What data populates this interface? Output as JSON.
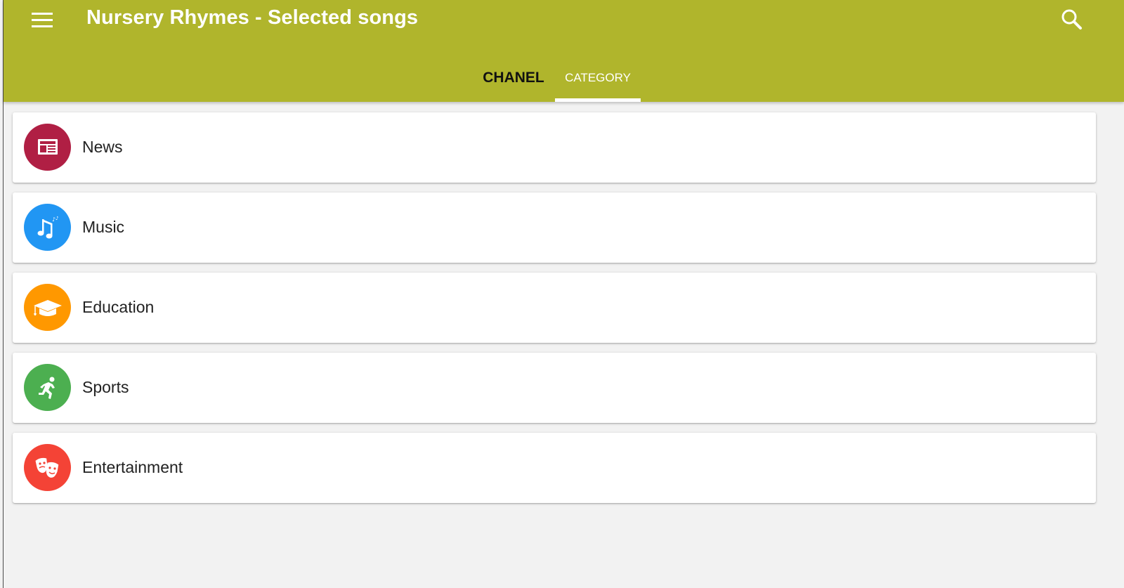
{
  "app": {
    "title": "Nursery Rhymes - Selected songs"
  },
  "tabs": [
    {
      "label": "CHANEL",
      "active": false
    },
    {
      "label": "CATEGORY",
      "active": true
    }
  ],
  "colors": {
    "appbar": "#b0b52c",
    "background": "#f2f2f2",
    "active_tab_indicator": "#ffffff"
  },
  "categories": [
    {
      "label": "News",
      "icon": "newspaper-icon",
      "color": "#b01f44"
    },
    {
      "label": "Music",
      "icon": "music-note-icon",
      "color": "#2196f3"
    },
    {
      "label": "Education",
      "icon": "graduation-cap-icon",
      "color": "#ff9800"
    },
    {
      "label": "Sports",
      "icon": "running-person-icon",
      "color": "#4caf50"
    },
    {
      "label": "Entertainment",
      "icon": "theater-masks-icon",
      "color": "#f44336"
    }
  ]
}
